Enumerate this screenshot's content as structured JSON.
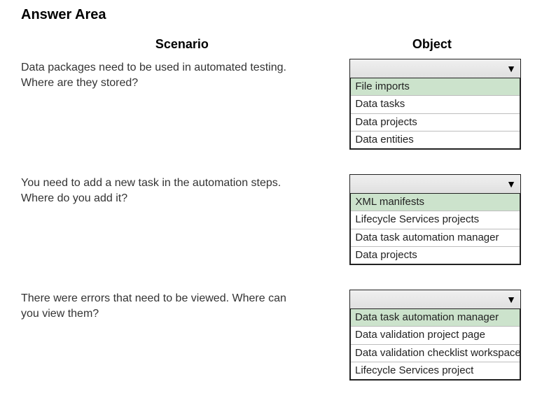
{
  "title": "Answer Area",
  "headers": {
    "scenario": "Scenario",
    "object": "Object"
  },
  "rows": [
    {
      "scenario": "Data packages need to be used in automated testing. Where are they stored?",
      "options": [
        {
          "label": "File imports",
          "selected": true
        },
        {
          "label": "Data tasks",
          "selected": false
        },
        {
          "label": "Data projects",
          "selected": false
        },
        {
          "label": "Data entities",
          "selected": false
        }
      ]
    },
    {
      "scenario": "You need to add a new task in the automation steps. Where do you add it?",
      "options": [
        {
          "label": "XML manifests",
          "selected": true
        },
        {
          "label": "Lifecycle Services projects",
          "selected": false
        },
        {
          "label": "Data task automation manager",
          "selected": false
        },
        {
          "label": "Data projects",
          "selected": false
        }
      ]
    },
    {
      "scenario": "There were errors that need to be viewed. Where can you view them?",
      "options": [
        {
          "label": "Data task automation  manager",
          "selected": true
        },
        {
          "label": "Data validation project page",
          "selected": false
        },
        {
          "label": "Data validation checklist workspace",
          "selected": false
        },
        {
          "label": "Lifecycle Services project",
          "selected": false
        }
      ]
    }
  ]
}
